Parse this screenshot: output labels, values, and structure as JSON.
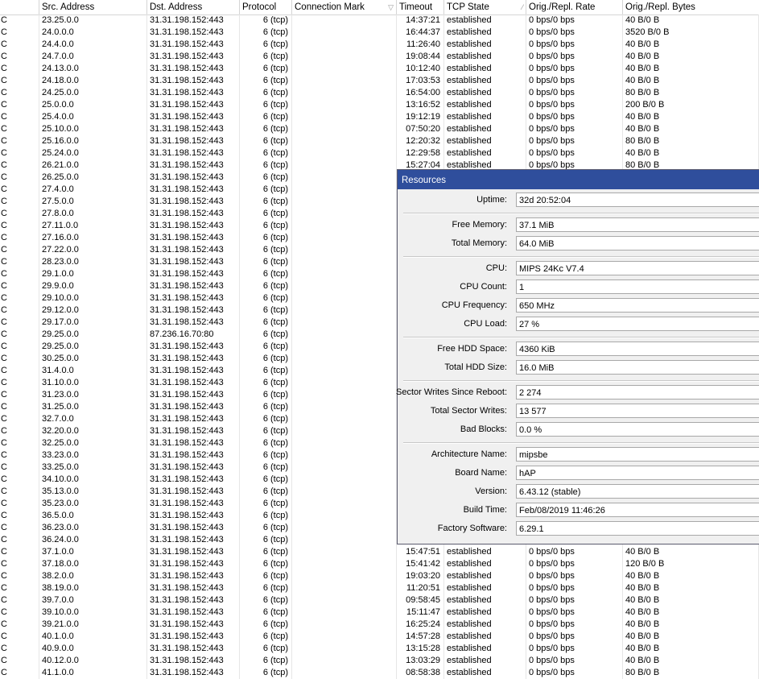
{
  "columns": [
    {
      "label": ""
    },
    {
      "label": "Src. Address"
    },
    {
      "label": "Dst. Address"
    },
    {
      "label": "Protocol"
    },
    {
      "label": "Connection Mark"
    },
    {
      "label": "Timeout"
    },
    {
      "label": "TCP State"
    },
    {
      "label": "Orig./Repl. Rate"
    },
    {
      "label": "Orig./Repl. Bytes"
    }
  ],
  "rows": [
    {
      "flag": "C",
      "src": "23.25.0.0",
      "dst": "31.31.198.152:443",
      "proto": "6 (tcp)",
      "mark": "",
      "timeout": "14:37:21",
      "state": "established",
      "rate": "0 bps/0 bps",
      "bytes": "40 B/0 B"
    },
    {
      "flag": "C",
      "src": "24.0.0.0",
      "dst": "31.31.198.152:443",
      "proto": "6 (tcp)",
      "mark": "",
      "timeout": "16:44:37",
      "state": "established",
      "rate": "0 bps/0 bps",
      "bytes": "3520 B/0 B"
    },
    {
      "flag": "C",
      "src": "24.4.0.0",
      "dst": "31.31.198.152:443",
      "proto": "6 (tcp)",
      "mark": "",
      "timeout": "11:26:40",
      "state": "established",
      "rate": "0 bps/0 bps",
      "bytes": "40 B/0 B"
    },
    {
      "flag": "C",
      "src": "24.7.0.0",
      "dst": "31.31.198.152:443",
      "proto": "6 (tcp)",
      "mark": "",
      "timeout": "19:08:44",
      "state": "established",
      "rate": "0 bps/0 bps",
      "bytes": "40 B/0 B"
    },
    {
      "flag": "C",
      "src": "24.13.0.0",
      "dst": "31.31.198.152:443",
      "proto": "6 (tcp)",
      "mark": "",
      "timeout": "10:12:40",
      "state": "established",
      "rate": "0 bps/0 bps",
      "bytes": "40 B/0 B"
    },
    {
      "flag": "C",
      "src": "24.18.0.0",
      "dst": "31.31.198.152:443",
      "proto": "6 (tcp)",
      "mark": "",
      "timeout": "17:03:53",
      "state": "established",
      "rate": "0 bps/0 bps",
      "bytes": "40 B/0 B"
    },
    {
      "flag": "C",
      "src": "24.25.0.0",
      "dst": "31.31.198.152:443",
      "proto": "6 (tcp)",
      "mark": "",
      "timeout": "16:54:00",
      "state": "established",
      "rate": "0 bps/0 bps",
      "bytes": "80 B/0 B"
    },
    {
      "flag": "C",
      "src": "25.0.0.0",
      "dst": "31.31.198.152:443",
      "proto": "6 (tcp)",
      "mark": "",
      "timeout": "13:16:52",
      "state": "established",
      "rate": "0 bps/0 bps",
      "bytes": "200 B/0 B"
    },
    {
      "flag": "C",
      "src": "25.4.0.0",
      "dst": "31.31.198.152:443",
      "proto": "6 (tcp)",
      "mark": "",
      "timeout": "19:12:19",
      "state": "established",
      "rate": "0 bps/0 bps",
      "bytes": "40 B/0 B"
    },
    {
      "flag": "C",
      "src": "25.10.0.0",
      "dst": "31.31.198.152:443",
      "proto": "6 (tcp)",
      "mark": "",
      "timeout": "07:50:20",
      "state": "established",
      "rate": "0 bps/0 bps",
      "bytes": "40 B/0 B"
    },
    {
      "flag": "C",
      "src": "25.16.0.0",
      "dst": "31.31.198.152:443",
      "proto": "6 (tcp)",
      "mark": "",
      "timeout": "12:20:32",
      "state": "established",
      "rate": "0 bps/0 bps",
      "bytes": "80 B/0 B"
    },
    {
      "flag": "C",
      "src": "25.24.0.0",
      "dst": "31.31.198.152:443",
      "proto": "6 (tcp)",
      "mark": "",
      "timeout": "12:29:58",
      "state": "established",
      "rate": "0 bps/0 bps",
      "bytes": "40 B/0 B"
    },
    {
      "flag": "C",
      "src": "26.21.0.0",
      "dst": "31.31.198.152:443",
      "proto": "6 (tcp)",
      "mark": "",
      "timeout": "15:27:04",
      "state": "established",
      "rate": "0 bps/0 bps",
      "bytes": "80 B/0 B"
    },
    {
      "flag": "C",
      "src": "26.25.0.0",
      "dst": "31.31.198.152:443",
      "proto": "6 (tcp)",
      "mark": "",
      "timeout": "",
      "state": "",
      "rate": "",
      "bytes": ""
    },
    {
      "flag": "C",
      "src": "27.4.0.0",
      "dst": "31.31.198.152:443",
      "proto": "6 (tcp)",
      "mark": "",
      "timeout": "",
      "state": "",
      "rate": "",
      "bytes": ""
    },
    {
      "flag": "C",
      "src": "27.5.0.0",
      "dst": "31.31.198.152:443",
      "proto": "6 (tcp)",
      "mark": "",
      "timeout": "",
      "state": "",
      "rate": "",
      "bytes": ""
    },
    {
      "flag": "C",
      "src": "27.8.0.0",
      "dst": "31.31.198.152:443",
      "proto": "6 (tcp)",
      "mark": "",
      "timeout": "",
      "state": "",
      "rate": "",
      "bytes": ""
    },
    {
      "flag": "C",
      "src": "27.11.0.0",
      "dst": "31.31.198.152:443",
      "proto": "6 (tcp)",
      "mark": "",
      "timeout": "",
      "state": "",
      "rate": "",
      "bytes": ""
    },
    {
      "flag": "C",
      "src": "27.16.0.0",
      "dst": "31.31.198.152:443",
      "proto": "6 (tcp)",
      "mark": "",
      "timeout": "",
      "state": "",
      "rate": "",
      "bytes": ""
    },
    {
      "flag": "C",
      "src": "27.22.0.0",
      "dst": "31.31.198.152:443",
      "proto": "6 (tcp)",
      "mark": "",
      "timeout": "",
      "state": "",
      "rate": "",
      "bytes": ""
    },
    {
      "flag": "C",
      "src": "28.23.0.0",
      "dst": "31.31.198.152:443",
      "proto": "6 (tcp)",
      "mark": "",
      "timeout": "",
      "state": "",
      "rate": "",
      "bytes": ""
    },
    {
      "flag": "C",
      "src": "29.1.0.0",
      "dst": "31.31.198.152:443",
      "proto": "6 (tcp)",
      "mark": "",
      "timeout": "",
      "state": "",
      "rate": "",
      "bytes": ""
    },
    {
      "flag": "C",
      "src": "29.9.0.0",
      "dst": "31.31.198.152:443",
      "proto": "6 (tcp)",
      "mark": "",
      "timeout": "",
      "state": "",
      "rate": "",
      "bytes": ""
    },
    {
      "flag": "C",
      "src": "29.10.0.0",
      "dst": "31.31.198.152:443",
      "proto": "6 (tcp)",
      "mark": "",
      "timeout": "",
      "state": "",
      "rate": "",
      "bytes": ""
    },
    {
      "flag": "C",
      "src": "29.12.0.0",
      "dst": "31.31.198.152:443",
      "proto": "6 (tcp)",
      "mark": "",
      "timeout": "",
      "state": "",
      "rate": "",
      "bytes": ""
    },
    {
      "flag": "C",
      "src": "29.17.0.0",
      "dst": "31.31.198.152:443",
      "proto": "6 (tcp)",
      "mark": "",
      "timeout": "",
      "state": "",
      "rate": "",
      "bytes": ""
    },
    {
      "flag": "C",
      "src": "29.25.0.0",
      "dst": "87.236.16.70:80",
      "proto": "6 (tcp)",
      "mark": "",
      "timeout": "",
      "state": "",
      "rate": "",
      "bytes": ""
    },
    {
      "flag": "C",
      "src": "29.25.0.0",
      "dst": "31.31.198.152:443",
      "proto": "6 (tcp)",
      "mark": "",
      "timeout": "",
      "state": "",
      "rate": "",
      "bytes": ""
    },
    {
      "flag": "C",
      "src": "30.25.0.0",
      "dst": "31.31.198.152:443",
      "proto": "6 (tcp)",
      "mark": "",
      "timeout": "",
      "state": "",
      "rate": "",
      "bytes": ""
    },
    {
      "flag": "C",
      "src": "31.4.0.0",
      "dst": "31.31.198.152:443",
      "proto": "6 (tcp)",
      "mark": "",
      "timeout": "",
      "state": "",
      "rate": "",
      "bytes": ""
    },
    {
      "flag": "C",
      "src": "31.10.0.0",
      "dst": "31.31.198.152:443",
      "proto": "6 (tcp)",
      "mark": "",
      "timeout": "",
      "state": "",
      "rate": "",
      "bytes": ""
    },
    {
      "flag": "C",
      "src": "31.23.0.0",
      "dst": "31.31.198.152:443",
      "proto": "6 (tcp)",
      "mark": "",
      "timeout": "",
      "state": "",
      "rate": "",
      "bytes": ""
    },
    {
      "flag": "C",
      "src": "31.25.0.0",
      "dst": "31.31.198.152:443",
      "proto": "6 (tcp)",
      "mark": "",
      "timeout": "",
      "state": "",
      "rate": "",
      "bytes": ""
    },
    {
      "flag": "C",
      "src": "32.7.0.0",
      "dst": "31.31.198.152:443",
      "proto": "6 (tcp)",
      "mark": "",
      "timeout": "",
      "state": "",
      "rate": "",
      "bytes": ""
    },
    {
      "flag": "C",
      "src": "32.20.0.0",
      "dst": "31.31.198.152:443",
      "proto": "6 (tcp)",
      "mark": "",
      "timeout": "",
      "state": "",
      "rate": "",
      "bytes": ""
    },
    {
      "flag": "C",
      "src": "32.25.0.0",
      "dst": "31.31.198.152:443",
      "proto": "6 (tcp)",
      "mark": "",
      "timeout": "",
      "state": "",
      "rate": "",
      "bytes": ""
    },
    {
      "flag": "C",
      "src": "33.23.0.0",
      "dst": "31.31.198.152:443",
      "proto": "6 (tcp)",
      "mark": "",
      "timeout": "",
      "state": "",
      "rate": "",
      "bytes": ""
    },
    {
      "flag": "C",
      "src": "33.25.0.0",
      "dst": "31.31.198.152:443",
      "proto": "6 (tcp)",
      "mark": "",
      "timeout": "",
      "state": "",
      "rate": "",
      "bytes": ""
    },
    {
      "flag": "C",
      "src": "34.10.0.0",
      "dst": "31.31.198.152:443",
      "proto": "6 (tcp)",
      "mark": "",
      "timeout": "",
      "state": "",
      "rate": "",
      "bytes": ""
    },
    {
      "flag": "C",
      "src": "35.13.0.0",
      "dst": "31.31.198.152:443",
      "proto": "6 (tcp)",
      "mark": "",
      "timeout": "",
      "state": "",
      "rate": "",
      "bytes": ""
    },
    {
      "flag": "C",
      "src": "35.23.0.0",
      "dst": "31.31.198.152:443",
      "proto": "6 (tcp)",
      "mark": "",
      "timeout": "",
      "state": "",
      "rate": "",
      "bytes": ""
    },
    {
      "flag": "C",
      "src": "36.5.0.0",
      "dst": "31.31.198.152:443",
      "proto": "6 (tcp)",
      "mark": "",
      "timeout": "",
      "state": "",
      "rate": "",
      "bytes": ""
    },
    {
      "flag": "C",
      "src": "36.23.0.0",
      "dst": "31.31.198.152:443",
      "proto": "6 (tcp)",
      "mark": "",
      "timeout": "",
      "state": "",
      "rate": "",
      "bytes": ""
    },
    {
      "flag": "C",
      "src": "36.24.0.0",
      "dst": "31.31.198.152:443",
      "proto": "6 (tcp)",
      "mark": "",
      "timeout": "",
      "state": "",
      "rate": "",
      "bytes": ""
    },
    {
      "flag": "C",
      "src": "37.1.0.0",
      "dst": "31.31.198.152:443",
      "proto": "6 (tcp)",
      "mark": "",
      "timeout": "15:47:51",
      "state": "established",
      "rate": "0 bps/0 bps",
      "bytes": "40 B/0 B"
    },
    {
      "flag": "C",
      "src": "37.18.0.0",
      "dst": "31.31.198.152:443",
      "proto": "6 (tcp)",
      "mark": "",
      "timeout": "15:41:42",
      "state": "established",
      "rate": "0 bps/0 bps",
      "bytes": "120 B/0 B"
    },
    {
      "flag": "C",
      "src": "38.2.0.0",
      "dst": "31.31.198.152:443",
      "proto": "6 (tcp)",
      "mark": "",
      "timeout": "19:03:20",
      "state": "established",
      "rate": "0 bps/0 bps",
      "bytes": "40 B/0 B"
    },
    {
      "flag": "C",
      "src": "38.19.0.0",
      "dst": "31.31.198.152:443",
      "proto": "6 (tcp)",
      "mark": "",
      "timeout": "11:20:51",
      "state": "established",
      "rate": "0 bps/0 bps",
      "bytes": "40 B/0 B"
    },
    {
      "flag": "C",
      "src": "39.7.0.0",
      "dst": "31.31.198.152:443",
      "proto": "6 (tcp)",
      "mark": "",
      "timeout": "09:58:45",
      "state": "established",
      "rate": "0 bps/0 bps",
      "bytes": "40 B/0 B"
    },
    {
      "flag": "C",
      "src": "39.10.0.0",
      "dst": "31.31.198.152:443",
      "proto": "6 (tcp)",
      "mark": "",
      "timeout": "15:11:47",
      "state": "established",
      "rate": "0 bps/0 bps",
      "bytes": "40 B/0 B"
    },
    {
      "flag": "C",
      "src": "39.21.0.0",
      "dst": "31.31.198.152:443",
      "proto": "6 (tcp)",
      "mark": "",
      "timeout": "16:25:24",
      "state": "established",
      "rate": "0 bps/0 bps",
      "bytes": "40 B/0 B"
    },
    {
      "flag": "C",
      "src": "40.1.0.0",
      "dst": "31.31.198.152:443",
      "proto": "6 (tcp)",
      "mark": "",
      "timeout": "14:57:28",
      "state": "established",
      "rate": "0 bps/0 bps",
      "bytes": "40 B/0 B"
    },
    {
      "flag": "C",
      "src": "40.9.0.0",
      "dst": "31.31.198.152:443",
      "proto": "6 (tcp)",
      "mark": "",
      "timeout": "13:15:28",
      "state": "established",
      "rate": "0 bps/0 bps",
      "bytes": "40 B/0 B"
    },
    {
      "flag": "C",
      "src": "40.12.0.0",
      "dst": "31.31.198.152:443",
      "proto": "6 (tcp)",
      "mark": "",
      "timeout": "13:03:29",
      "state": "established",
      "rate": "0 bps/0 bps",
      "bytes": "40 B/0 B"
    },
    {
      "flag": "C",
      "src": "41.1.0.0",
      "dst": "31.31.198.152:443",
      "proto": "6 (tcp)",
      "mark": "",
      "timeout": "08:58:38",
      "state": "established",
      "rate": "0 bps/0 bps",
      "bytes": "80 B/0 B"
    }
  ],
  "resources": {
    "title": "Resources",
    "groups": [
      [
        {
          "label": "Uptime:",
          "value": "32d 20:52:04"
        }
      ],
      [
        {
          "label": "Free Memory:",
          "value": "37.1 MiB"
        },
        {
          "label": "Total Memory:",
          "value": "64.0 MiB"
        }
      ],
      [
        {
          "label": "CPU:",
          "value": "MIPS 24Kc V7.4"
        },
        {
          "label": "CPU Count:",
          "value": "1"
        },
        {
          "label": "CPU Frequency:",
          "value": "650 MHz"
        },
        {
          "label": "CPU Load:",
          "value": "27 %"
        }
      ],
      [
        {
          "label": "Free HDD Space:",
          "value": "4360 KiB"
        },
        {
          "label": "Total HDD Size:",
          "value": "16.0 MiB"
        }
      ],
      [
        {
          "label": "Sector Writes Since Reboot:",
          "value": "2 274"
        },
        {
          "label": "Total Sector Writes:",
          "value": "13 577"
        },
        {
          "label": "Bad Blocks:",
          "value": "0.0 %"
        }
      ],
      [
        {
          "label": "Architecture Name:",
          "value": "mipsbe"
        },
        {
          "label": "Board Name:",
          "value": "hAP"
        },
        {
          "label": "Version:",
          "value": "6.43.12 (stable)"
        },
        {
          "label": "Build Time:",
          "value": "Feb/08/2019 11:46:26"
        },
        {
          "label": "Factory Software:",
          "value": "6.29.1"
        }
      ]
    ]
  }
}
